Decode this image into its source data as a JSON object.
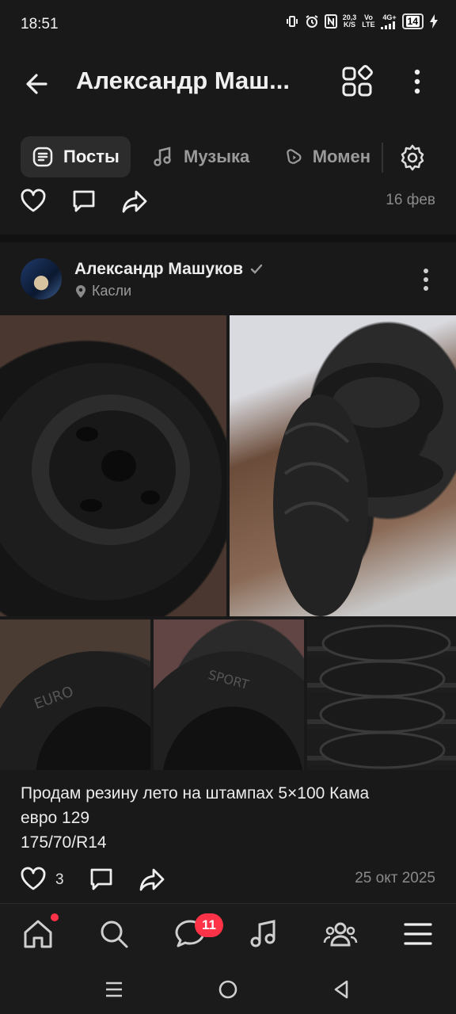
{
  "status_bar": {
    "time": "18:51",
    "net_speed_value": "20,3",
    "net_speed_unit": "K/S",
    "volte_top": "Vo",
    "volte_bottom": "LTE",
    "network": "4G+",
    "battery": "14"
  },
  "header": {
    "title": "Александр Маш..."
  },
  "tabs": [
    {
      "label": "Посты",
      "icon": "posts-icon",
      "active": true
    },
    {
      "label": "Музыка",
      "icon": "music-icon",
      "active": false
    },
    {
      "label": "Момен",
      "icon": "moments-icon",
      "active": false
    }
  ],
  "previous_post": {
    "date": "16 фев"
  },
  "post": {
    "author": "Александр Машуков",
    "location": "Касли",
    "text_lines": [
      "Продам резину лето на штампах 5×100 Кама",
      "евро 129",
      "175/70/R14"
    ],
    "likes": "3",
    "date": "25 окт 2025",
    "photos": [
      "tire-photo-1",
      "tire-photo-2",
      "tire-photo-3",
      "tire-photo-4",
      "tire-photo-5"
    ]
  },
  "bottom_nav": {
    "items": [
      "home-icon",
      "search-icon",
      "messages-icon",
      "music-icon",
      "friends-icon",
      "menu-icon"
    ],
    "messages_badge": "11"
  },
  "colors": {
    "background": "#191919",
    "badge": "#ff3347",
    "text": "#ececec",
    "muted": "#8a8a8a"
  }
}
